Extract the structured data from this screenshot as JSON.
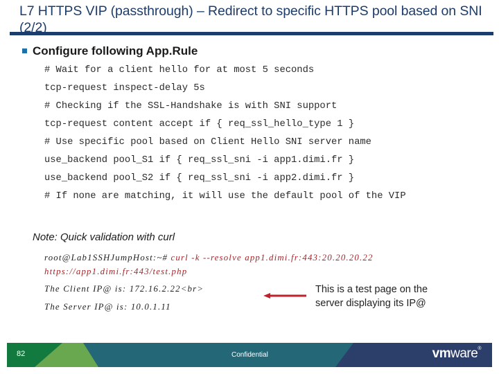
{
  "title": "L7 HTTPS VIP (passthrough) – Redirect to specific HTTPS pool based on SNI (2/2)",
  "bullet": "Configure following App.Rule",
  "code_lines": [
    "# Wait for a client hello for at most 5 seconds",
    "tcp-request inspect-delay 5s",
    "# Checking if the SSL-Handshake is with SNI support",
    "tcp-request content accept if { req_ssl_hello_type 1 }",
    "# Use specific pool based on Client Hello SNI server name",
    "use_backend pool_S1 if { req_ssl_sni -i app1.dimi.fr }",
    "use_backend pool_S2 if { req_ssl_sni -i app2.dimi.fr }",
    "# If none are matching, it will use the default pool of the VIP"
  ],
  "note": "Note: Quick validation with curl",
  "command": {
    "prompt": "root@Lab1SSHJumpHost:~# ",
    "cmd_line1": "curl -k --resolve app1.dimi.fr:443:20.20.20.22",
    "cmd_line2": "https://app1.dimi.fr:443/test.php"
  },
  "output_lines": [
    "The Client IP@ is: 172.16.2.22<br>",
    "The Server IP@ is: 10.0.1.11"
  ],
  "callout": "This is a test page on the server displaying its IP@",
  "colors": {
    "title": "#1d3c6a",
    "rule": "#1a3d6e",
    "arrow": "#c0202a",
    "command_red": "#a3262a",
    "footer_green_dark": "#127a3e",
    "footer_green_light": "#6aa84f",
    "footer_teal": "#246878",
    "footer_navy": "#2c3f6b"
  },
  "footer": {
    "page_number": "82",
    "confidential": "Confidential",
    "logo_bold": "vm",
    "logo_light": "ware",
    "logo_mark": "®"
  }
}
